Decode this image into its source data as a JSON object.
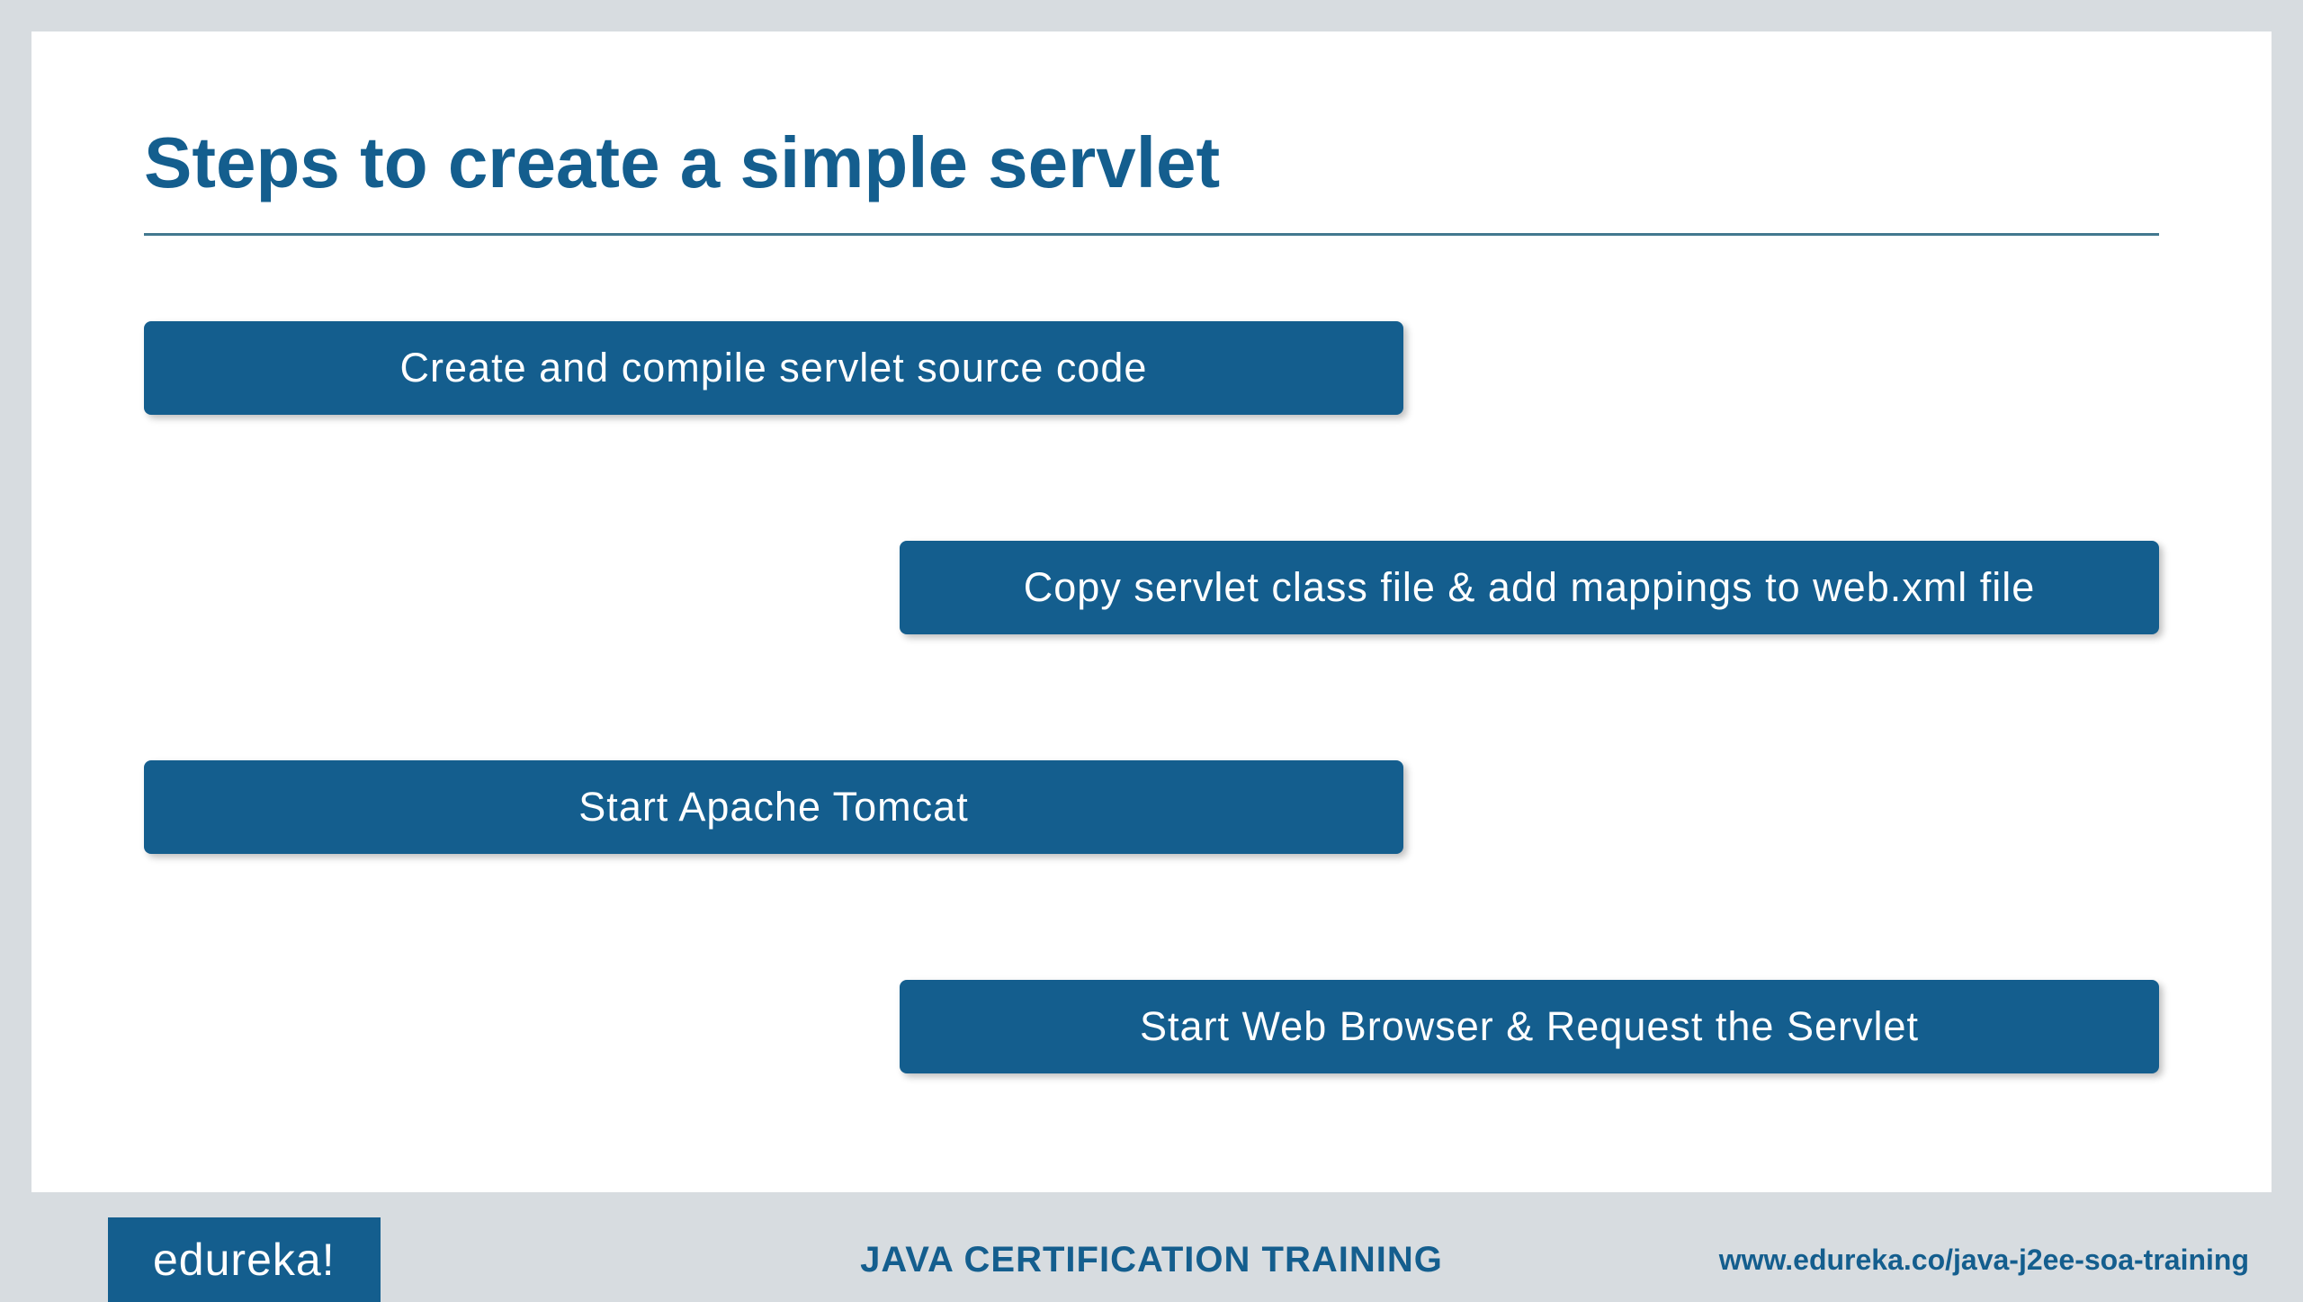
{
  "title": "Steps to create a simple servlet",
  "steps": [
    {
      "label": "Create and compile servlet source code"
    },
    {
      "label": "Copy servlet class file & add mappings to web.xml file"
    },
    {
      "label": "Start Apache Tomcat"
    },
    {
      "label": "Start Web Browser & Request the Servlet"
    }
  ],
  "footer": {
    "logo": "edureka!",
    "center": "JAVA CERTIFICATION TRAINING",
    "url": "www.edureka.co/java-j2ee-soa-training"
  }
}
